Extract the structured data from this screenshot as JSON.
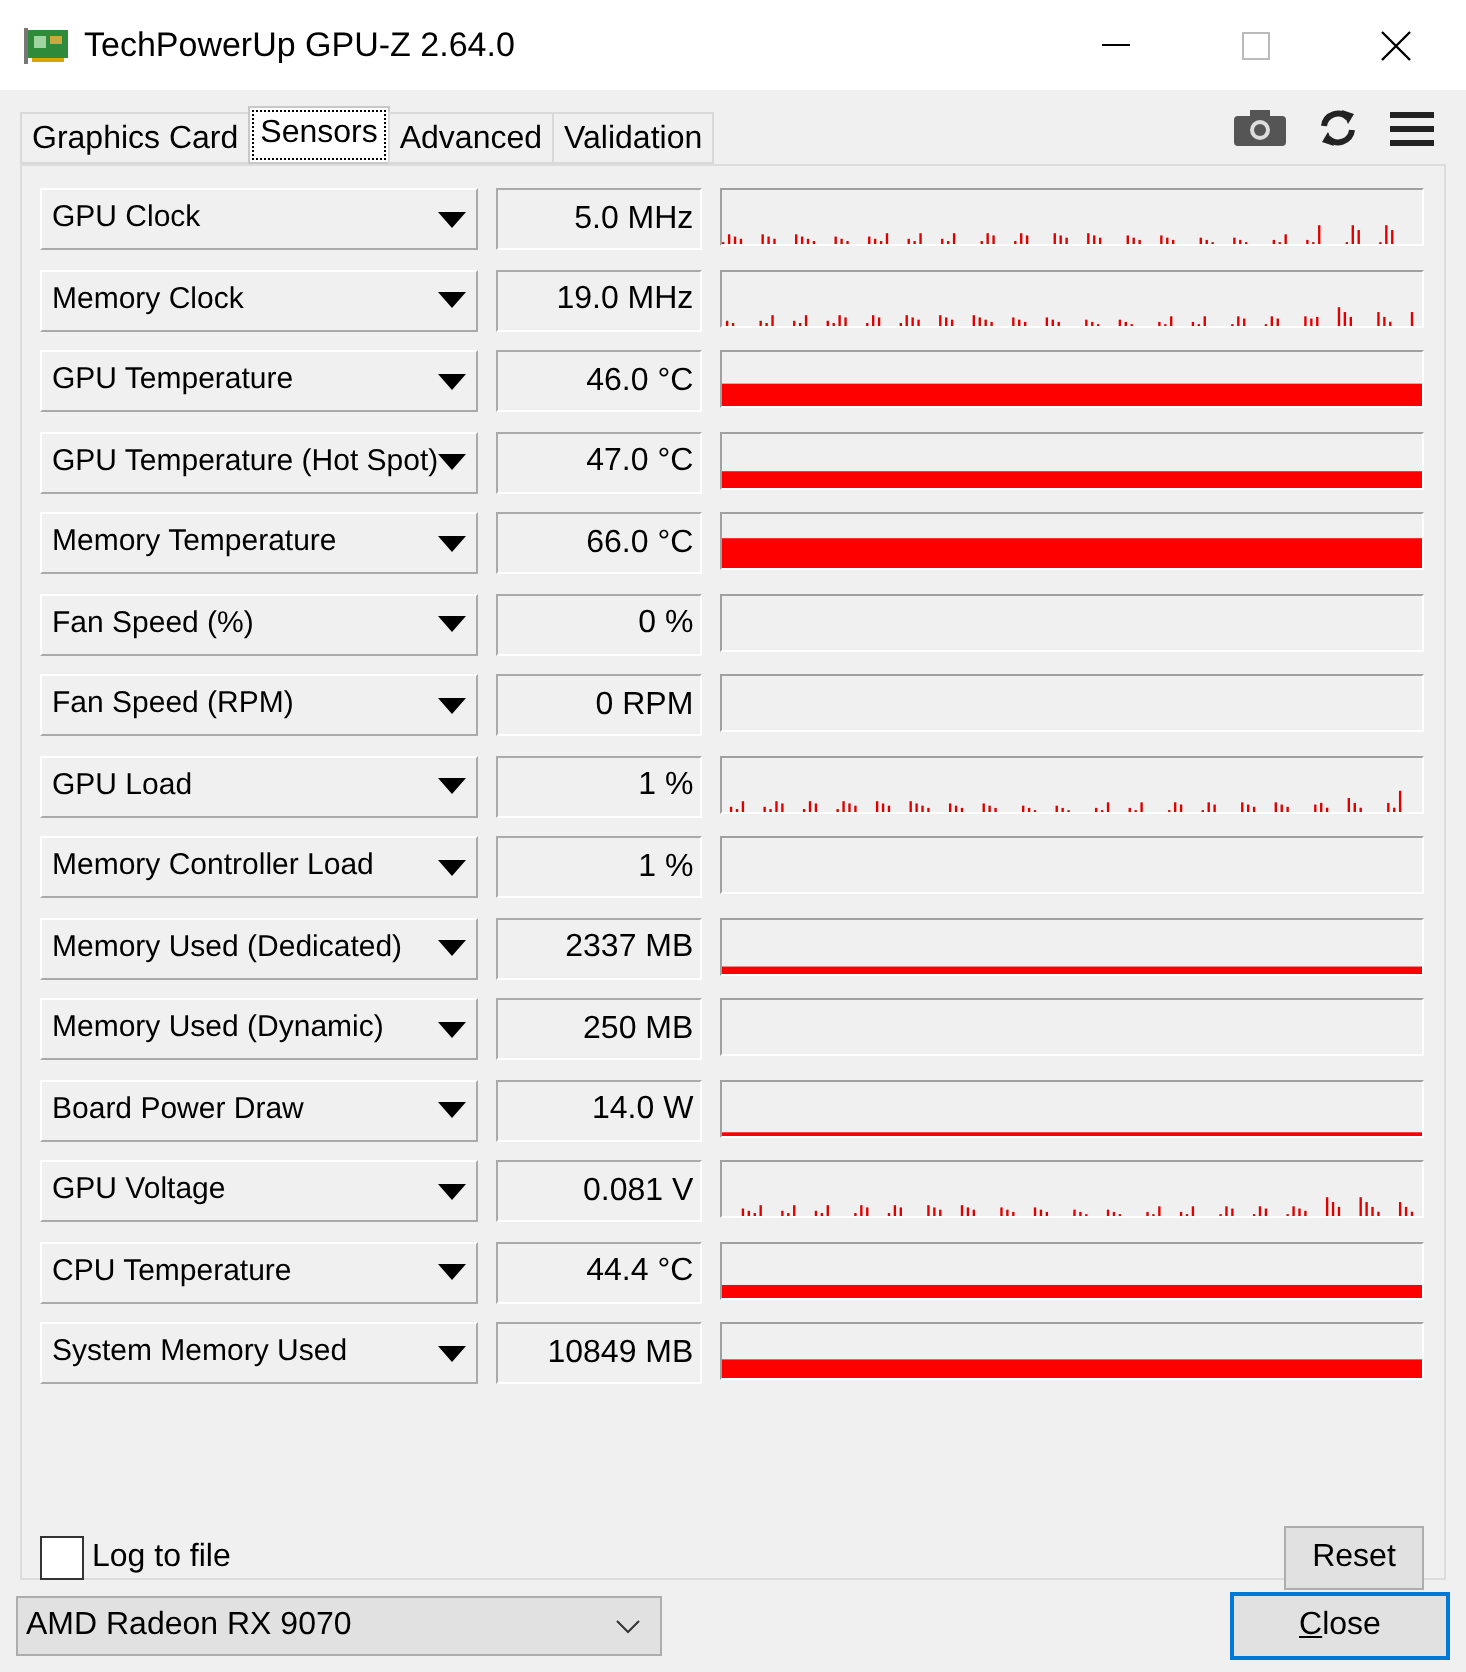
{
  "window": {
    "title": "TechPowerUp GPU-Z 2.64.0"
  },
  "tabs": [
    {
      "label": "Graphics Card",
      "selected": false
    },
    {
      "label": "Sensors",
      "selected": true
    },
    {
      "label": "Advanced",
      "selected": false
    },
    {
      "label": "Validation",
      "selected": false
    }
  ],
  "sensors": [
    {
      "name": "GPU Clock",
      "reading": "5.0 MHz",
      "kind": "spikes"
    },
    {
      "name": "Memory Clock",
      "reading": "19.0 MHz",
      "kind": "spikes"
    },
    {
      "name": "GPU Temperature",
      "reading": "46.0 °C",
      "kind": "bar"
    },
    {
      "name": "GPU Temperature (Hot Spot)",
      "reading": "47.0 °C",
      "kind": "bar"
    },
    {
      "name": "Memory Temperature",
      "reading": "66.0 °C",
      "kind": "bar"
    },
    {
      "name": "Fan Speed (%)",
      "reading": "0 %",
      "kind": "empty"
    },
    {
      "name": "Fan Speed (RPM)",
      "reading": "0 RPM",
      "kind": "empty"
    },
    {
      "name": "GPU Load",
      "reading": "1 %",
      "kind": "spikes"
    },
    {
      "name": "Memory Controller Load",
      "reading": "1 %",
      "kind": "empty"
    },
    {
      "name": "Memory Used (Dedicated)",
      "reading": "2337 MB",
      "kind": "bar"
    },
    {
      "name": "Memory Used (Dynamic)",
      "reading": "250 MB",
      "kind": "empty"
    },
    {
      "name": "Board Power Draw",
      "reading": "14.0 W",
      "kind": "bar"
    },
    {
      "name": "GPU Voltage",
      "reading": "0.081 V",
      "kind": "spikes"
    },
    {
      "name": "CPU Temperature",
      "reading": "44.4 °C",
      "kind": "bar"
    },
    {
      "name": "System Memory Used",
      "reading": "10849 MB",
      "kind": "bar"
    }
  ],
  "log_to_file": {
    "label": "Log to file",
    "checked": false
  },
  "reset_button": "Reset",
  "gpu_select": "AMD Radeon RX 9070",
  "close_button": "Close"
}
